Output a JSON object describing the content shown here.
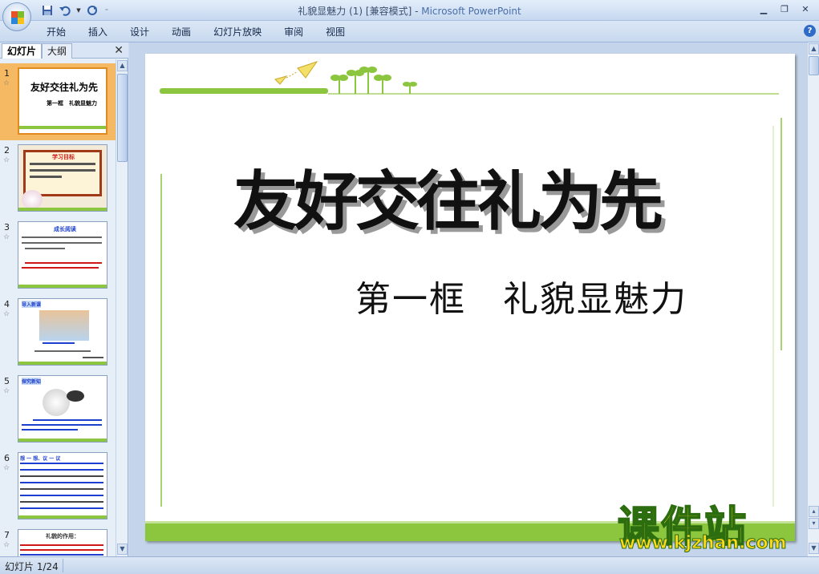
{
  "window": {
    "title_doc": "礼貌显魅力 (1) [兼容模式]",
    "title_sep": " - ",
    "title_app": "Microsoft PowerPoint"
  },
  "ribbon": {
    "tabs": [
      "开始",
      "插入",
      "设计",
      "动画",
      "幻灯片放映",
      "审阅",
      "视图"
    ],
    "help": "?"
  },
  "panel": {
    "tab_slides": "幻灯片",
    "tab_outline": "大纲",
    "close": "✕"
  },
  "thumbnails": [
    {
      "num": "1",
      "title": "友好交往礼为先",
      "subtitle": "第一框　礼貌显魅力"
    },
    {
      "num": "2",
      "title": "学习目标"
    },
    {
      "num": "3",
      "title": "成长阅读"
    },
    {
      "num": "4",
      "title": "导入新课"
    },
    {
      "num": "5",
      "title": "探究新知"
    },
    {
      "num": "6",
      "title": "想 一 想、议 一 议"
    },
    {
      "num": "7",
      "title": "礼貌的作用："
    }
  ],
  "slide": {
    "title": "友好交往礼为先",
    "subtitle": "第一框　礼貌显魅力"
  },
  "watermark": {
    "cn": "课件站",
    "url": "www.kjzhan.com"
  },
  "status": {
    "slide_counter": "幻灯片 1/24"
  },
  "colors": {
    "accent_green": "#8cc63f",
    "selected_thumb": "#f6b963",
    "watermark_yellow": "#ffd91a"
  }
}
